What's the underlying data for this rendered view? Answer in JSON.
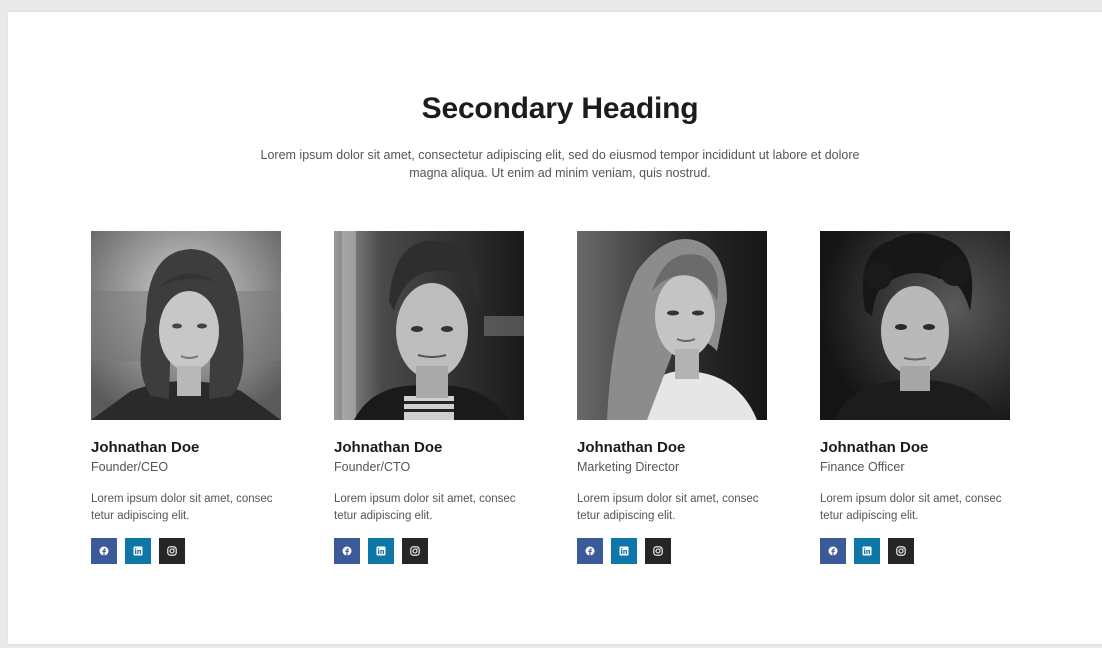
{
  "section": {
    "heading": "Secondary Heading",
    "subtext": "Lorem ipsum dolor sit amet, consectetur adipiscing elit, sed do eiusmod tempor incididunt ut labore et dolore magna aliqua. Ut enim ad minim veniam, quis nostrud."
  },
  "team": [
    {
      "name": "Johnathan Doe",
      "role": "Founder/CEO",
      "bio": "Lorem ipsum dolor sit amet, consec tetur adipiscing elit."
    },
    {
      "name": "Johnathan Doe",
      "role": "Founder/CTO",
      "bio": "Lorem ipsum dolor sit amet, consec tetur adipiscing elit."
    },
    {
      "name": "Johnathan Doe",
      "role": "Marketing Director",
      "bio": "Lorem ipsum dolor sit amet, consec tetur adipiscing elit."
    },
    {
      "name": "Johnathan Doe",
      "role": "Finance Officer",
      "bio": "Lorem ipsum dolor sit amet, consec tetur adipiscing elit."
    }
  ],
  "social_icons": [
    "facebook-icon",
    "linkedin-icon",
    "instagram-icon"
  ],
  "colors": {
    "facebook": "#3b5a9a",
    "linkedin": "#0e76a8",
    "instagram": "#262626",
    "heading": "#1c1c1c",
    "body_text": "#555555"
  }
}
